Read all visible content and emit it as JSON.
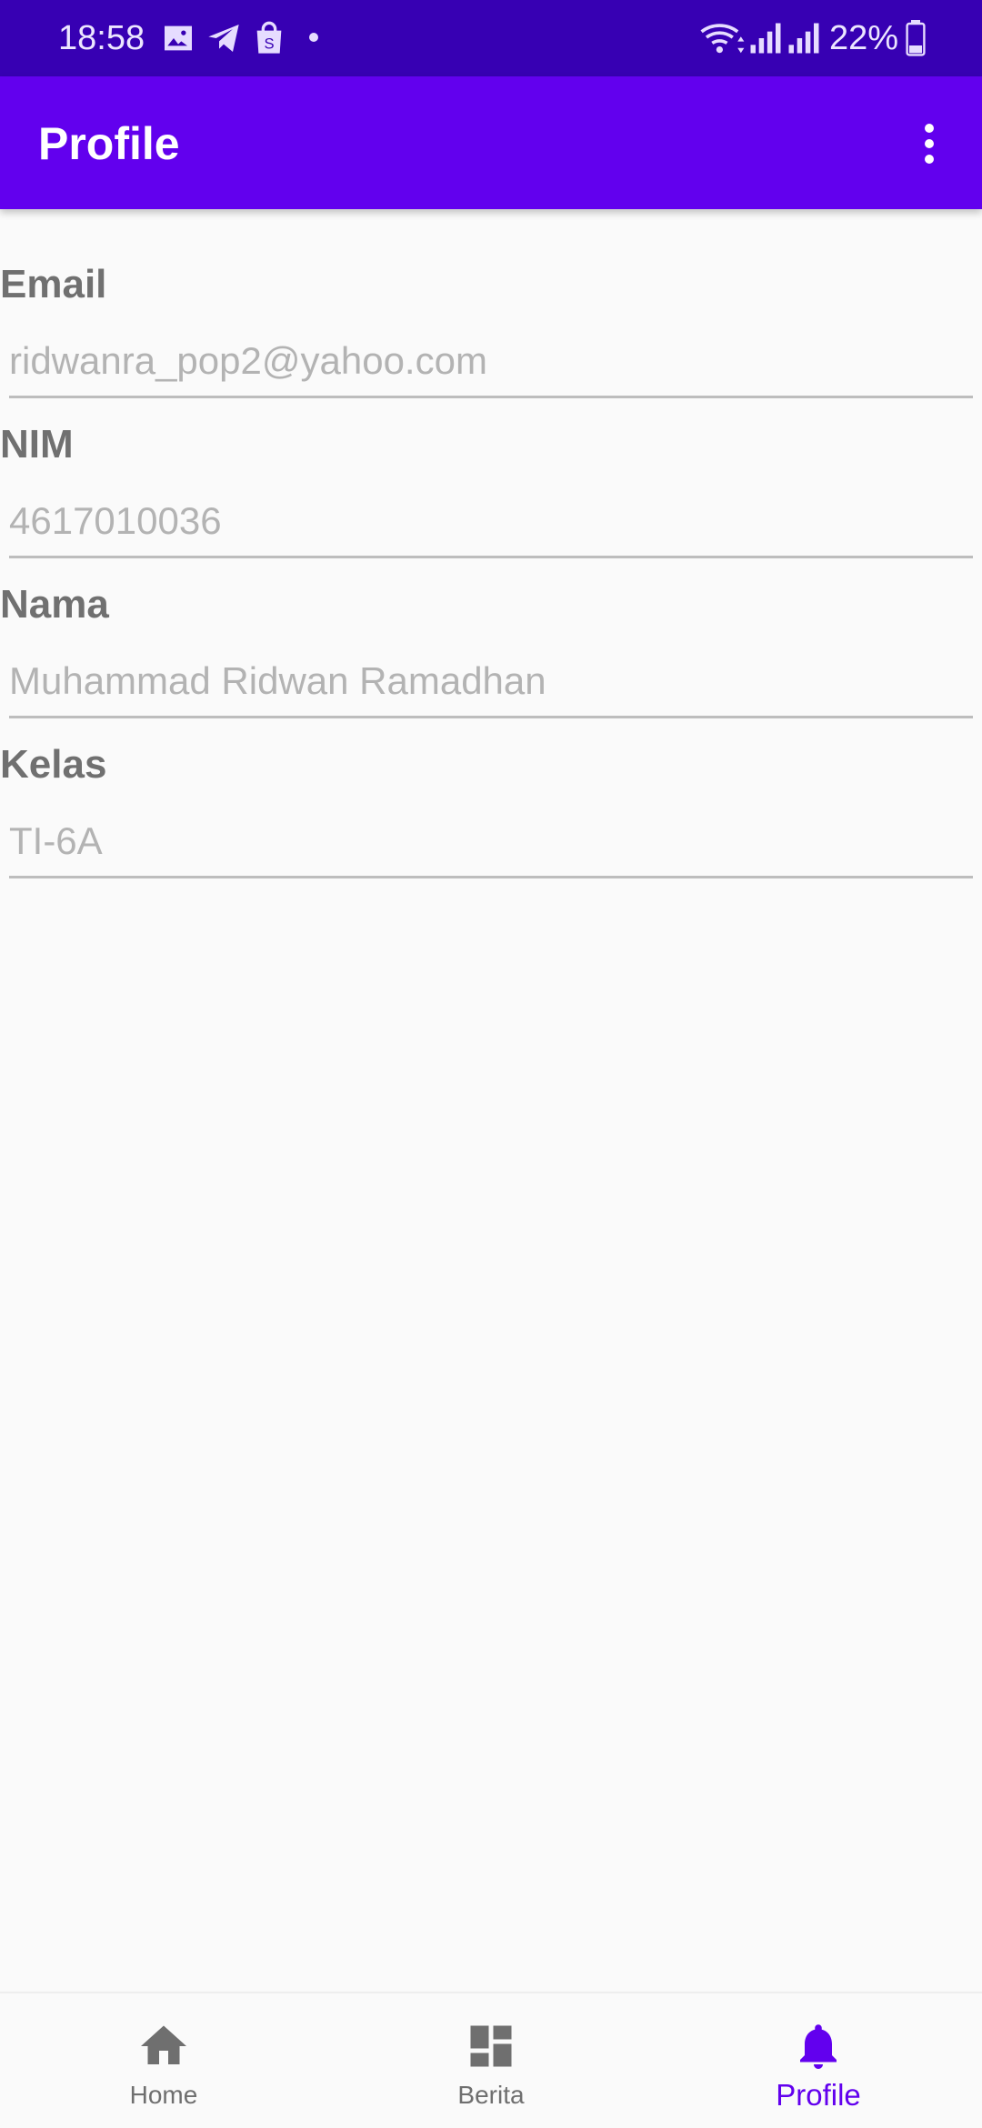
{
  "status_bar": {
    "time": "18:58",
    "battery_percent": "22%",
    "notification_icons": [
      "image-icon",
      "telegram-icon",
      "shopping-bag-icon",
      "dot-icon"
    ],
    "system_icons": [
      "wifi-icon",
      "signal-icon",
      "signal-icon",
      "battery-icon"
    ]
  },
  "app_bar": {
    "title": "Profile",
    "menu_icon": "more-vertical-icon"
  },
  "form": {
    "fields": [
      {
        "label": "Email",
        "value": "ridwanra_pop2@yahoo.com"
      },
      {
        "label": "NIM",
        "value": "4617010036"
      },
      {
        "label": "Nama",
        "value": "Muhammad Ridwan Ramadhan"
      },
      {
        "label": "Kelas",
        "value": "TI-6A"
      }
    ]
  },
  "bottom_nav": {
    "items": [
      {
        "label": "Home",
        "icon": "home-icon",
        "active": false
      },
      {
        "label": "Berita",
        "icon": "dashboard-icon",
        "active": false
      },
      {
        "label": "Profile",
        "icon": "bell-icon",
        "active": true
      }
    ]
  },
  "colors": {
    "status_bar": "#3700b3",
    "app_bar": "#6200ee",
    "accent": "#6200ee",
    "inactive_nav": "#6f6f6f",
    "background": "#fafafa"
  }
}
